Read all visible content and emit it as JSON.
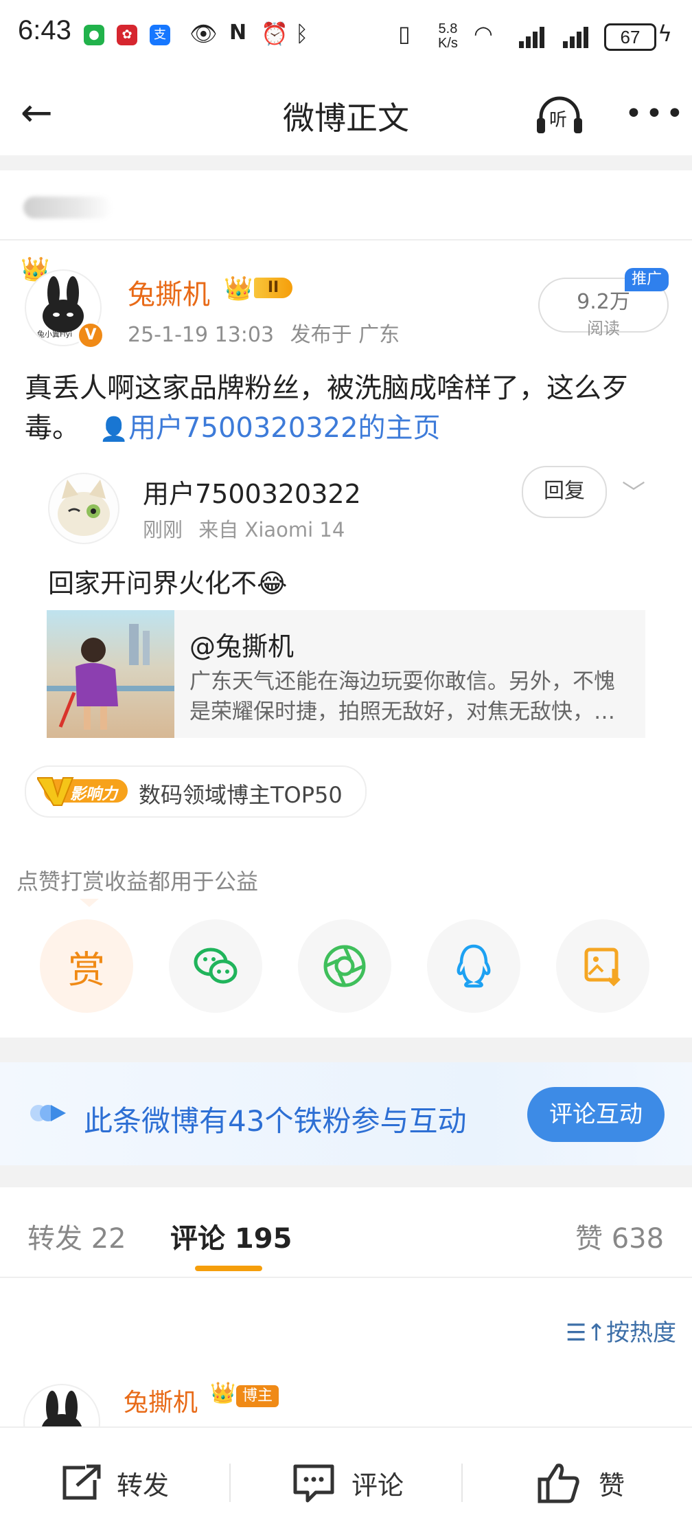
{
  "status_bar": {
    "time": "6:43",
    "net_speed_value": "5.8",
    "net_speed_unit": "K/s",
    "battery": "67"
  },
  "header": {
    "title": "微博正文",
    "listen_label": "听"
  },
  "post": {
    "author": "兔撕机",
    "author_level": "II",
    "time": "25-1-19 13:03",
    "location": "发布于 广东",
    "reads_value": "9.2万",
    "reads_label": "阅读",
    "promo_badge": "推广",
    "text": "真丢人啊这家品牌粉丝，被洗脑成啥样了，这么歹毒。",
    "user_link": "用户7500320322的主页",
    "avatar_caption": "兔小翼Fiyi"
  },
  "repost": {
    "user": "用户7500320322",
    "time": "刚刚",
    "device": "来自 Xiaomi 14",
    "reply_label": "回复",
    "text": "回家开问界火化不😂",
    "card_title": "@兔撕机",
    "card_desc": "广东天气还能在海边玩耍你敢信。另外，不愧是荣耀保时捷，拍照无敌好，对焦无敌快，…"
  },
  "influence_tag": {
    "badge": "影响力",
    "text": "数码领域博主TOP50"
  },
  "share": {
    "title": "点赞打赏收益都用于公益",
    "reward_label": "赏",
    "items": [
      "reward",
      "wechat",
      "moments",
      "qq",
      "save-image"
    ]
  },
  "fans_banner": {
    "text": "此条微博有43个铁粉参与互动",
    "button": "评论互动"
  },
  "tabs": {
    "repost": "转发 22",
    "comment": "评论 195",
    "like": "赞 638"
  },
  "sort_label": "按热度",
  "comment_preview": {
    "name": "兔撕机",
    "badge": "博主"
  },
  "bottom_bar": {
    "repost": "转发",
    "comment": "评论",
    "like": "赞"
  },
  "colors": {
    "brand_orange": "#e86a17",
    "link_blue": "#3d7bd9",
    "accent_blue": "#3d8be6",
    "tab_underline": "#f59e0b"
  }
}
